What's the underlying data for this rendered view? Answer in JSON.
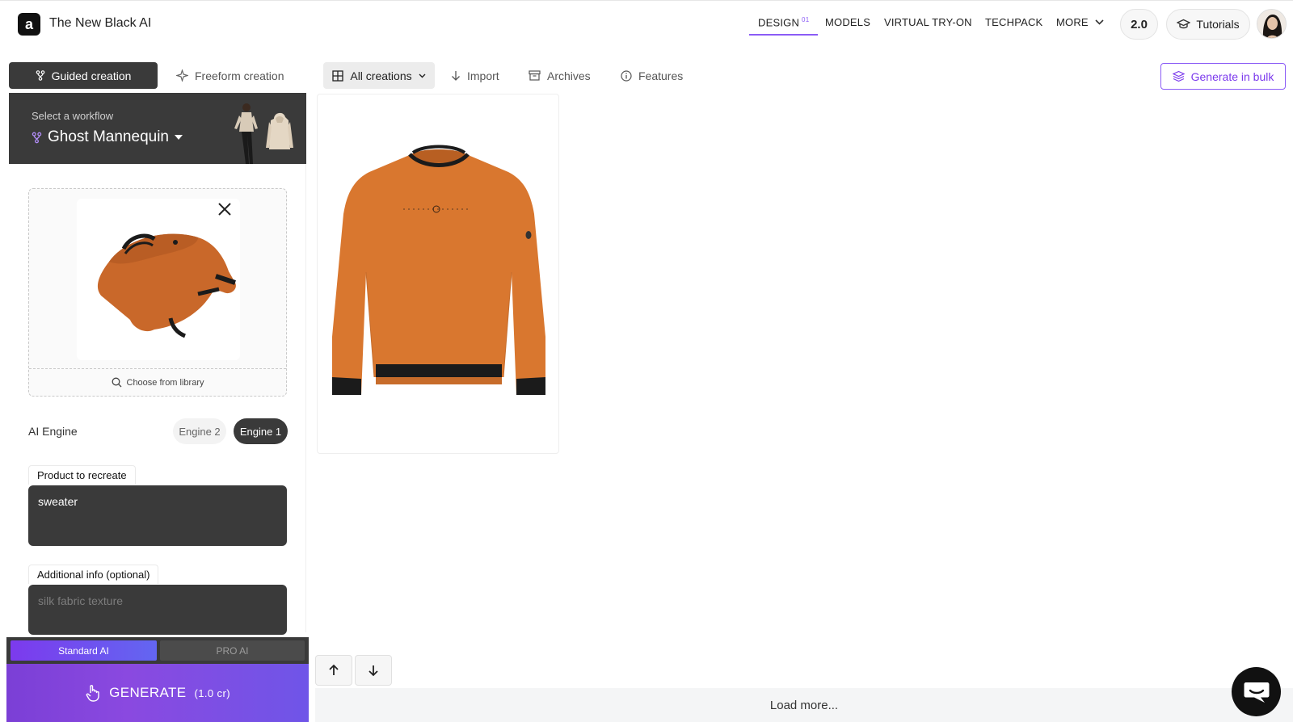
{
  "header": {
    "logo_glyph": "a",
    "app_title": "The New Black AI",
    "nav": [
      {
        "label": "DESIGN",
        "badge": "01"
      },
      {
        "label": "MODELS"
      },
      {
        "label": "VIRTUAL TRY-ON"
      },
      {
        "label": "TECHPACK"
      },
      {
        "label": "MORE"
      }
    ],
    "version": "2.0",
    "tutorials_label": "Tutorials"
  },
  "left": {
    "tabs": {
      "guided": "Guided creation",
      "freeform": "Freeform creation"
    },
    "workflow": {
      "label": "Select a workflow",
      "value": "Ghost Mannequin"
    },
    "upload": {
      "choose_label": "Choose from library"
    },
    "engine": {
      "label": "AI Engine",
      "options": [
        "Engine 2",
        "Engine 1"
      ],
      "selected": "Engine 1"
    },
    "product_field": {
      "label": "Product to recreate",
      "value": "sweater"
    },
    "additional_field": {
      "label": "Additional info (optional)",
      "placeholder": "silk fabric texture"
    },
    "ai_mode": {
      "standard": "Standard AI",
      "pro": "PRO AI",
      "selected": "Standard AI"
    },
    "generate": {
      "label": "GENERATE",
      "cost": "(1.0 cr)"
    }
  },
  "main": {
    "toolbar": {
      "all_creations": "All creations",
      "import": "Import",
      "archives": "Archives",
      "features": "Features",
      "generate_bulk": "Generate in bulk"
    },
    "load_more": "Load more..."
  },
  "colors": {
    "accent": "#8b5cf6",
    "dark_panel": "#3a3a3a",
    "sweater_orange": "#d9772f",
    "rib_black": "#1b1b1b"
  }
}
